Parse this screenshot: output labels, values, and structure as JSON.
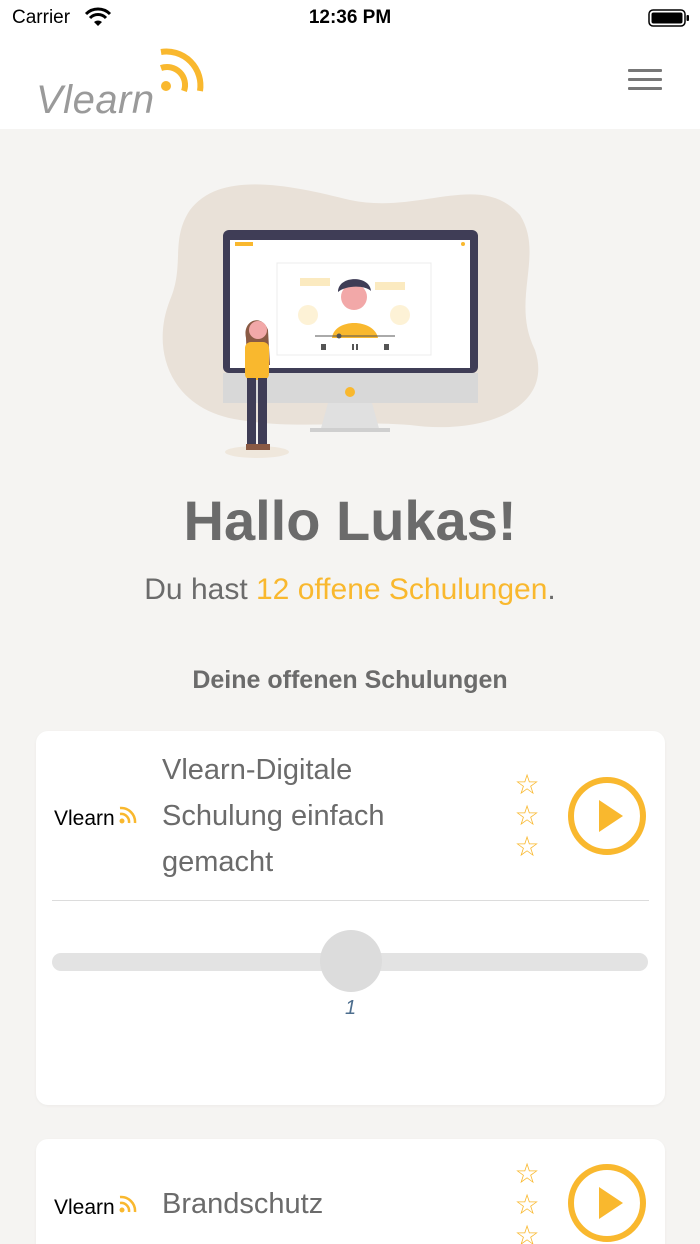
{
  "status_bar": {
    "carrier": "Carrier",
    "time": "12:36 PM"
  },
  "header": {
    "logo_text": "Vlearn",
    "menu_icon": "hamburger-menu-icon"
  },
  "greeting": {
    "title": "Hallo Lukas!",
    "prefix": "Du hast ",
    "highlight": "12 offene Schulungen",
    "suffix": "."
  },
  "section": {
    "title": "Deine offenen Schulungen"
  },
  "courses": [
    {
      "logo_text": "Vlearn",
      "title_lines": [
        "Vlearn-Digitale",
        "Schulung einfach",
        "gemacht"
      ],
      "stars": [
        "☆",
        "☆",
        "☆"
      ],
      "slider_value": "1",
      "slider_fraction": 0.5
    },
    {
      "logo_text": "Vlearn",
      "title_lines": [
        "Brandschutz"
      ],
      "stars": [
        "☆",
        "☆",
        "☆"
      ]
    }
  ],
  "colors": {
    "accent": "#f9b82e",
    "text": "#6b6b6b",
    "background": "#f5f4f2"
  }
}
